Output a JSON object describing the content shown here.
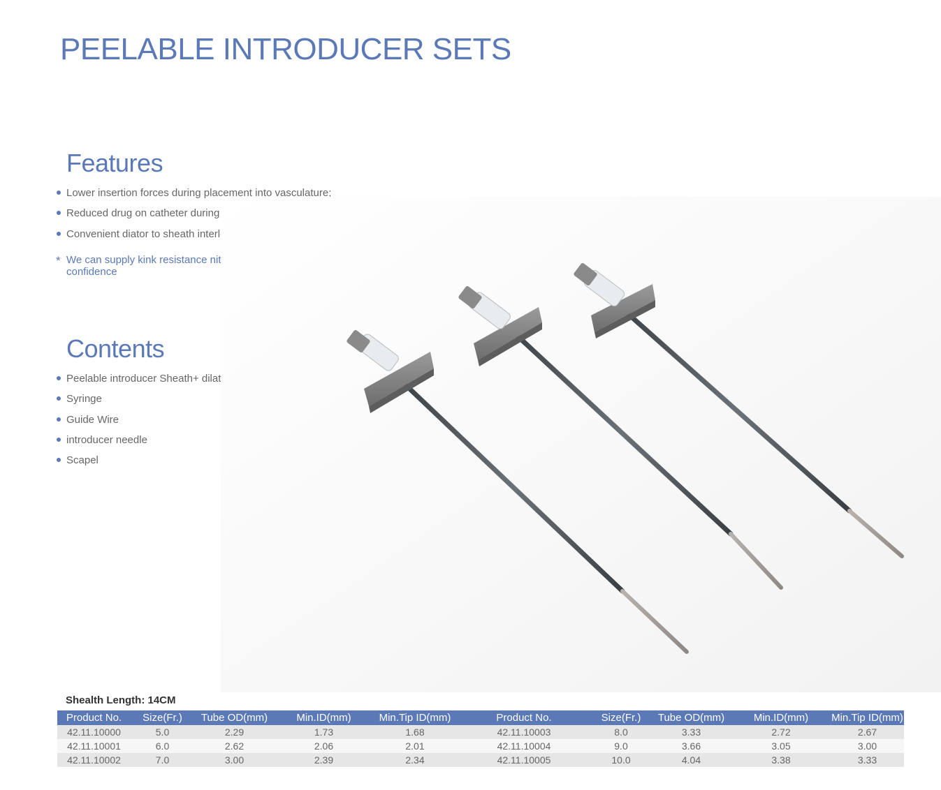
{
  "title": "PEELABLE INTRODUCER SETS",
  "features": {
    "heading": "Features",
    "items": [
      "Lower insertion forces during placement into vasculature;",
      "Reduced drug on catheter during placement during the sheath;",
      "Convenient diator to sheath interlock"
    ],
    "note_mark": "*",
    "note": "We can supply kink resistance nitinol guide wire to increase clinician confidence"
  },
  "contents": {
    "heading": "Contents",
    "items": [
      "Peelable introducer Sheath+ dilator",
      "Syringe",
      "Guide Wire",
      "introducer needle",
      "Scapel"
    ]
  },
  "colors": {
    "accent": "#5a79b6",
    "row_dark": "#e6e6e6",
    "row_light": "#f6f6f6"
  },
  "table": {
    "caption": "Shealth Length: 14CM",
    "headers": [
      "Product No.",
      "Size(Fr.)",
      "Tube OD(mm)",
      "Min.ID(mm)",
      "Min.Tip ID(mm)",
      "Product No.",
      "Size(Fr.)",
      "Tube OD(mm)",
      "Min.ID(mm)",
      "Min.Tip ID(mm)"
    ],
    "rows": [
      [
        "42.11.10000",
        "5.0",
        "2.29",
        "1.73",
        "1.68",
        "42.11.10003",
        "8.0",
        "3.33",
        "2.72",
        "2.67"
      ],
      [
        "42.11.10001",
        "6.0",
        "2.62",
        "2.06",
        "2.01",
        "42.11.10004",
        "9.0",
        "3.66",
        "3.05",
        "3.00"
      ],
      [
        "42.11.10002",
        "7.0",
        "3.00",
        "2.39",
        "2.34",
        "42.11.10005",
        "10.0",
        "4.04",
        "3.38",
        "3.33"
      ]
    ]
  }
}
